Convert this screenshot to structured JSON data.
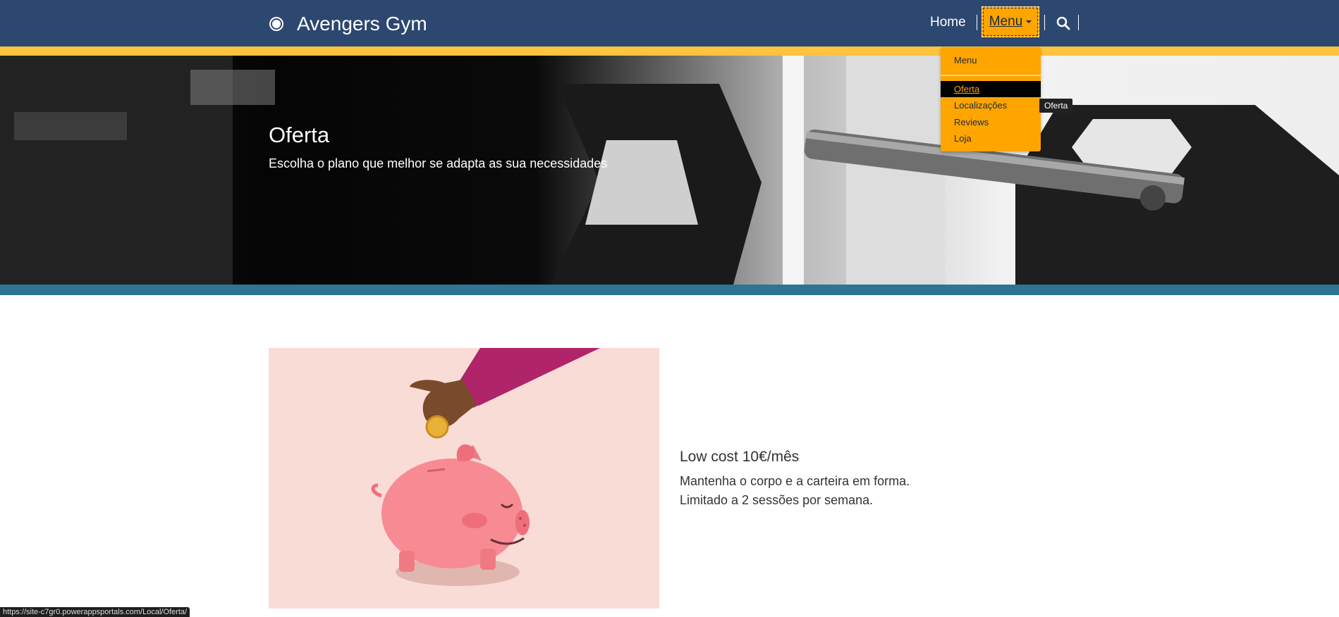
{
  "header": {
    "brand_name": "Avengers Gym",
    "nav_home": "Home",
    "nav_menu": "Menu"
  },
  "dropdown": {
    "header": "Menu",
    "items": [
      {
        "label": "Oferta",
        "active": true
      },
      {
        "label": "Localizações",
        "active": false
      },
      {
        "label": "Reviews",
        "active": false
      },
      {
        "label": "Loja",
        "active": false
      }
    ],
    "tooltip": "Oferta"
  },
  "hero": {
    "title": "Oferta",
    "subtitle": "Escolha o plano que melhor se adapta as sua necessidades"
  },
  "plan": {
    "title": "Low cost 10€/mês",
    "lines": [
      "Mantenha o corpo e a carteira em forma.",
      "Limitado a 2 sessões por semana."
    ]
  },
  "status_url": "https://site-c7gr0.powerappsportals.com/Local/Oferta/",
  "colors": {
    "header_bg": "#2c4770",
    "accent_yellow": "#ffc33d",
    "menu_orange": "#ffa500",
    "teal_bar": "#2e7595",
    "card_bg": "#fadcd6"
  }
}
